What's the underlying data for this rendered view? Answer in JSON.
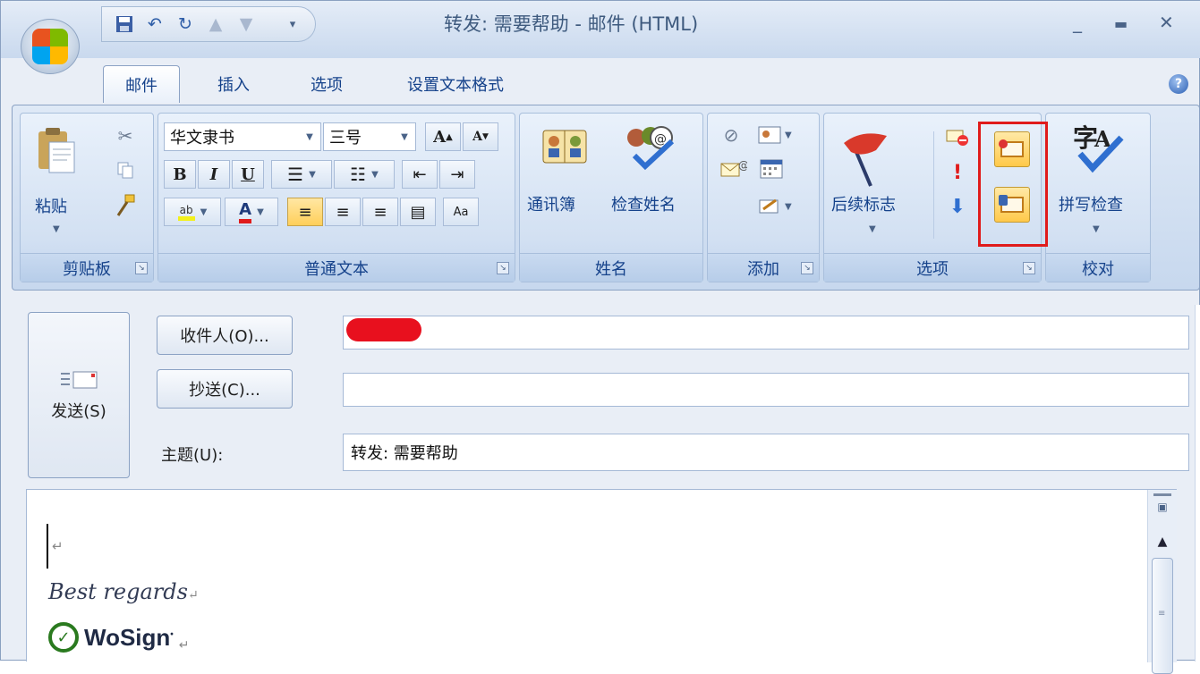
{
  "window": {
    "title": "转发: 需要帮助 - 邮件 (HTML)"
  },
  "tabs": [
    {
      "label": "邮件"
    },
    {
      "label": "插入"
    },
    {
      "label": "选项"
    },
    {
      "label": "设置文本格式"
    }
  ],
  "groups": {
    "clipboard": {
      "label": "剪贴板",
      "paste_label": "粘贴"
    },
    "basic_text": {
      "label": "普通文本",
      "font_name": "华文隶书",
      "font_size": "三号",
      "bold": "B",
      "italic": "I",
      "underline": "U",
      "grow": "A",
      "shrink": "A",
      "font_color": "A"
    },
    "names": {
      "label": "姓名",
      "address_book": "通讯簿",
      "check_names": "检查姓名"
    },
    "include": {
      "label": "添加"
    },
    "options": {
      "label": "选项",
      "follow_up": "后续标志"
    },
    "proofing": {
      "label": "校对",
      "spelling": "拼写检查",
      "spelling_icon_text": "字"
    }
  },
  "form": {
    "send_label": "发送(S)",
    "to_button": "收件人(O)...",
    "cc_button": "抄送(C)...",
    "subject_label": "主题(U):",
    "to_value": "",
    "cc_value": "",
    "subject_value": "转发: 需要帮助"
  },
  "body": {
    "signature_text": "Best regards",
    "logo_text": "WoSign"
  },
  "colors": {
    "highlight_box": "#e01b1b",
    "accent": "#15428b"
  }
}
